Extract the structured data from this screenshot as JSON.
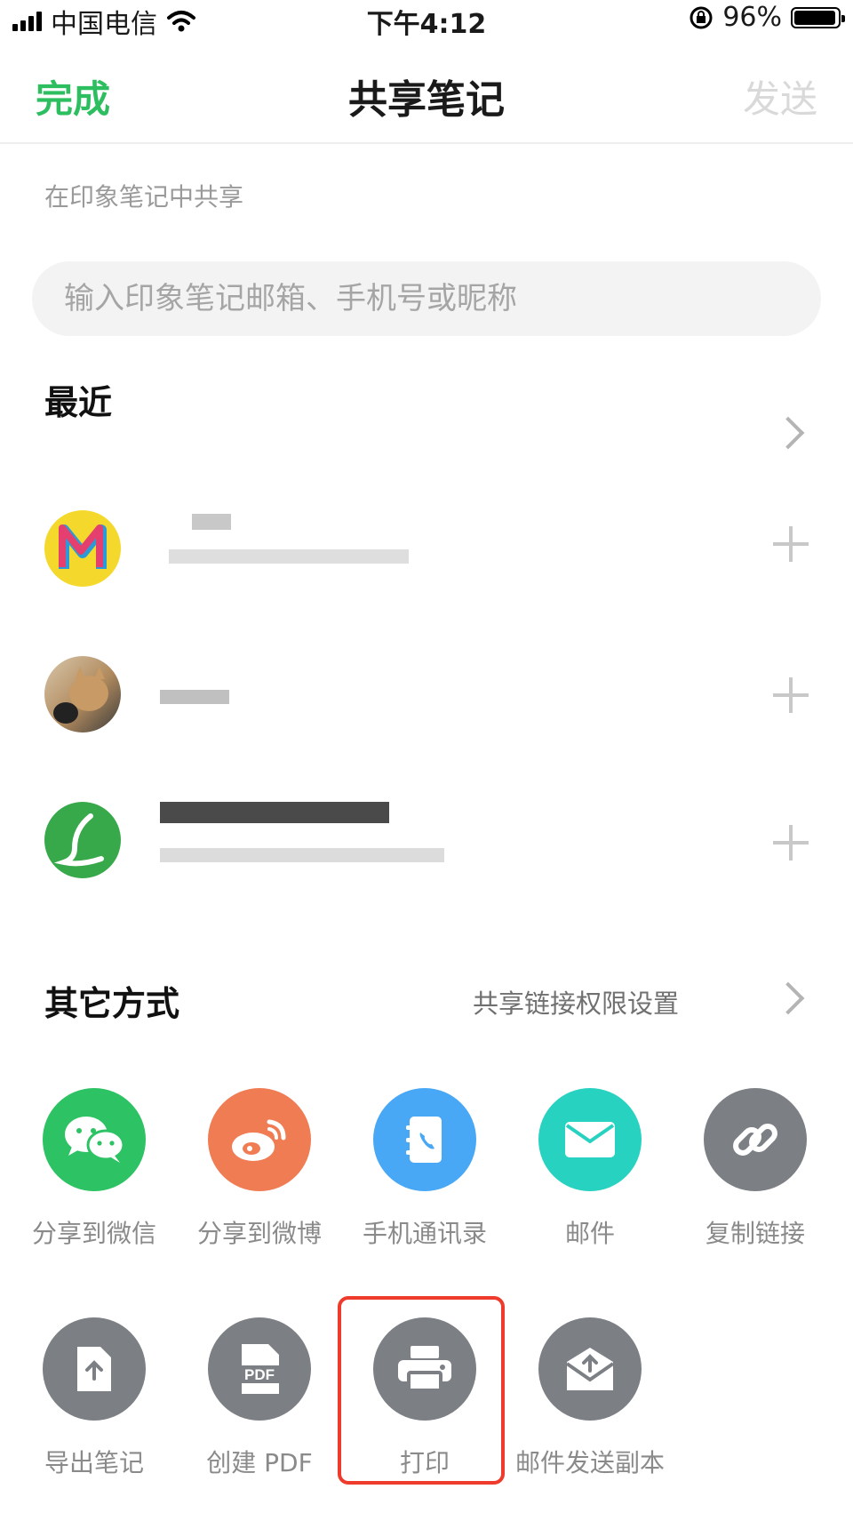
{
  "status_bar": {
    "carrier": "中国电信",
    "time": "下午4:12",
    "battery_percent": "96%",
    "battery_level": 0.96,
    "icons": [
      "signal-icon",
      "wifi-icon",
      "rotation-lock-icon",
      "battery-icon"
    ]
  },
  "nav": {
    "done_label": "完成",
    "title": "共享笔记",
    "send_label": "发送"
  },
  "share_in_app": {
    "label": "在印象笔记中共享",
    "search_placeholder": "输入印象笔记邮箱、手机号或昵称"
  },
  "recent": {
    "title": "最近",
    "contacts": [
      {
        "avatar": "letter-m-avatar",
        "name": "",
        "detail": ""
      },
      {
        "avatar": "cat-photo-avatar",
        "name": "",
        "detail": ""
      },
      {
        "avatar": "letter-l-avatar",
        "name": "",
        "detail": ""
      }
    ]
  },
  "other": {
    "title": "其它方式",
    "link_settings": "共享链接权限设置",
    "options_row1": [
      {
        "label": "分享到微信",
        "icon": "wechat-icon",
        "color": "#2dc263"
      },
      {
        "label": "分享到微博",
        "icon": "weibo-icon",
        "color": "#f07c54"
      },
      {
        "label": "手机通讯录",
        "icon": "contacts-book-icon",
        "color": "#49a8f5"
      },
      {
        "label": "邮件",
        "icon": "mail-icon",
        "color": "#27d2c0"
      },
      {
        "label": "复制链接",
        "icon": "link-icon",
        "color": "#7c8084"
      }
    ],
    "options_row2": [
      {
        "label": "导出笔记",
        "icon": "export-note-icon",
        "color": "#7c8084"
      },
      {
        "label": "创建 PDF",
        "icon": "pdf-icon",
        "color": "#7c8084",
        "badge": "PDF"
      },
      {
        "label": "打印",
        "icon": "printer-icon",
        "color": "#7c8084"
      },
      {
        "label": "邮件发送副本",
        "icon": "mail-copy-icon",
        "color": "#7c8084"
      }
    ]
  },
  "colors": {
    "accent_green": "#2dbe60",
    "highlight_red": "#ee3b2b"
  }
}
